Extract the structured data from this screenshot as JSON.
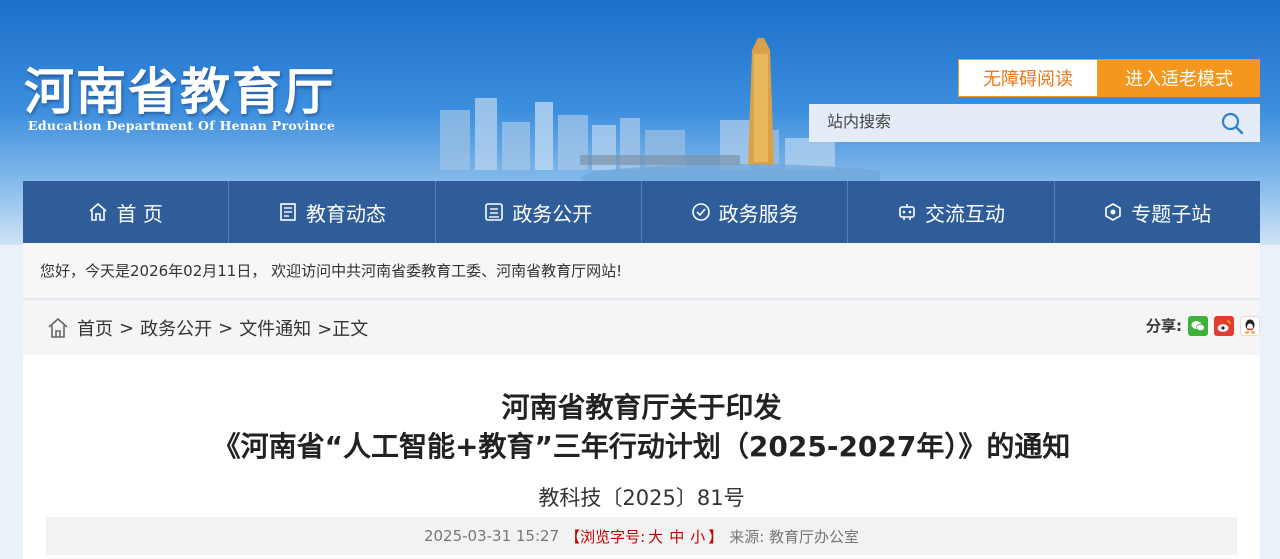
{
  "header": {
    "logo_cn": "河南省教育厅",
    "logo_en": "Education Department Of Henan Province",
    "accessible_btn": "无障碍阅读",
    "elderly_btn": "进入适老模式",
    "search_placeholder": "站内搜索"
  },
  "nav": {
    "items": [
      {
        "label": "首 页",
        "icon": "home-icon"
      },
      {
        "label": "教育动态",
        "icon": "news-icon"
      },
      {
        "label": "政务公开",
        "icon": "document-icon"
      },
      {
        "label": "政务服务",
        "icon": "service-icon"
      },
      {
        "label": "交流互动",
        "icon": "interaction-icon"
      },
      {
        "label": "专题子站",
        "icon": "topic-icon"
      }
    ]
  },
  "welcome": "您好，今天是2026年02月11日， 欢迎访问中共河南省委教育工委、河南省教育厅网站!",
  "breadcrumb": {
    "home": "首页",
    "sep": ">",
    "level1": "政务公开",
    "level2": "文件通知",
    "current": ">正文"
  },
  "share": {
    "label": "分享:"
  },
  "article": {
    "title_line1": "河南省教育厅关于印发",
    "title_line2": "《河南省“人工智能+教育”三年行动计划（2025-2027年）》的通知",
    "doc_no": "教科技〔2025〕81号",
    "date": "2025-03-31 15:27",
    "font_opt_prefix": "【浏览字号:",
    "font_large": "大",
    "font_medium": "中",
    "font_small": "小",
    "font_opt_suffix": "】",
    "source": "来源: 教育厅办公室"
  }
}
